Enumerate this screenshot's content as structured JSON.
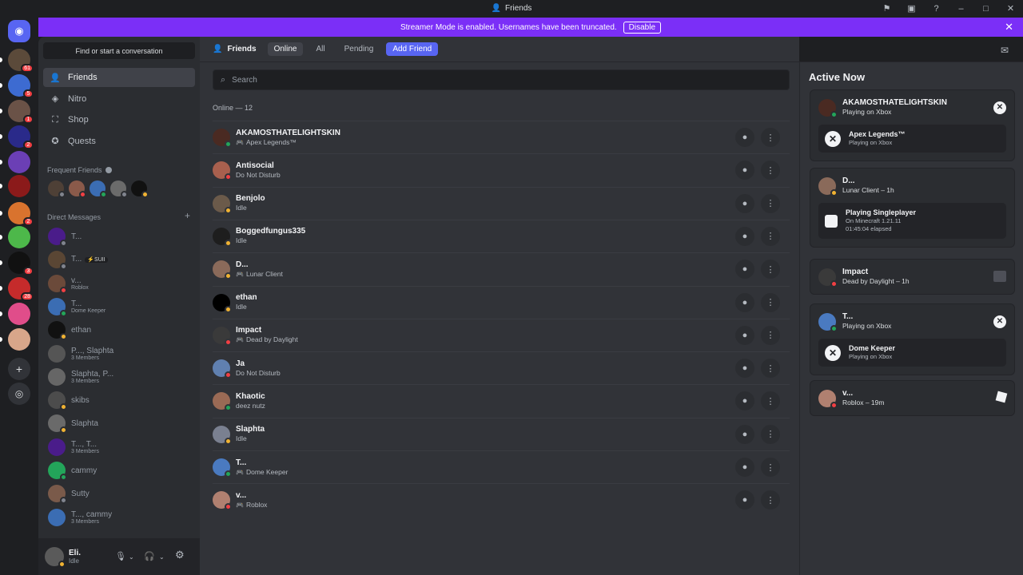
{
  "window": {
    "title": "Friends"
  },
  "banner": {
    "text": "Streamer Mode is enabled. Usernames have been truncated.",
    "button": "Disable"
  },
  "colors": {
    "accent": "#5865f2",
    "banner": "#7b2ff7",
    "online": "#23a55a",
    "idle": "#f0b232",
    "dnd": "#f23f43"
  },
  "servers": [
    {
      "badge": "61"
    },
    {
      "badge": "5"
    },
    {
      "badge": "1"
    },
    {
      "badge": "2"
    },
    {
      "badge": ""
    },
    {
      "badge": ""
    },
    {
      "badge": "2"
    },
    {
      "badge": ""
    },
    {
      "badge": "3"
    },
    {
      "badge": "28"
    },
    {
      "badge": ""
    },
    {
      "badge": ""
    }
  ],
  "sidebar": {
    "find": "Find or start a conversation",
    "nav": [
      {
        "label": "Friends",
        "icon": "friends-icon"
      },
      {
        "label": "Nitro",
        "icon": "nitro-icon"
      },
      {
        "label": "Shop",
        "icon": "shop-icon"
      },
      {
        "label": "Quests",
        "icon": "quests-icon"
      }
    ],
    "frequent_label": "Frequent Friends",
    "dm_label": "Direct Messages",
    "dms": [
      {
        "name": "T...",
        "sub": "",
        "tag": ""
      },
      {
        "name": "T...",
        "sub": "",
        "tag": "⚡SUII"
      },
      {
        "name": "v...",
        "sub": "Roblox",
        "tag": ""
      },
      {
        "name": "T...",
        "sub": "Dome Keeper",
        "tag": ""
      },
      {
        "name": "ethan",
        "sub": "",
        "tag": ""
      },
      {
        "name": "P..., Slaphta",
        "sub": "3 Members",
        "tag": ""
      },
      {
        "name": "Slaphta, P...",
        "sub": "3 Members",
        "tag": ""
      },
      {
        "name": "skibs",
        "sub": "",
        "tag": ""
      },
      {
        "name": "Slaphta",
        "sub": "",
        "tag": ""
      },
      {
        "name": "T..., T...",
        "sub": "3 Members",
        "tag": ""
      },
      {
        "name": "cammy",
        "sub": "",
        "tag": ""
      },
      {
        "name": "Sutty",
        "sub": "",
        "tag": ""
      },
      {
        "name": "T..., cammy",
        "sub": "3 Members",
        "tag": ""
      }
    ]
  },
  "user": {
    "name": "Eli.",
    "status": "Idle"
  },
  "topbar": {
    "title": "Friends",
    "tabs": [
      "Online",
      "All",
      "Pending"
    ],
    "add": "Add Friend"
  },
  "search": {
    "placeholder": "Search"
  },
  "online": {
    "heading": "Online — 12",
    "friends": [
      {
        "name": "AKAMOSTHATELIGHTSKIN",
        "status": "Apex Legends™",
        "game": true,
        "state": "online"
      },
      {
        "name": "Antisocial",
        "status": "Do Not Disturb",
        "game": false,
        "state": "dnd"
      },
      {
        "name": "Benjolo",
        "status": "Idle",
        "game": false,
        "state": "idle"
      },
      {
        "name": "Boggedfungus335",
        "status": "Idle",
        "game": false,
        "state": "idle"
      },
      {
        "name": "D...",
        "status": "Lunar Client",
        "game": true,
        "state": "idle"
      },
      {
        "name": "ethan",
        "status": "Idle",
        "game": false,
        "state": "idle"
      },
      {
        "name": "Impact",
        "status": "Dead by Daylight",
        "game": true,
        "state": "dnd"
      },
      {
        "name": "Ja",
        "status": "Do Not Disturb",
        "game": false,
        "state": "dnd"
      },
      {
        "name": "Khaotic",
        "status": "deez nutz",
        "game": false,
        "state": "online"
      },
      {
        "name": "Slaphta",
        "status": "Idle",
        "game": false,
        "state": "idle"
      },
      {
        "name": "T...",
        "status": "Dome Keeper",
        "game": true,
        "state": "online"
      },
      {
        "name": "v...",
        "status": "Roblox",
        "game": true,
        "state": "dnd"
      }
    ]
  },
  "active_now": {
    "title": "Active Now",
    "cards": [
      {
        "name": "AKAMOSTHATELIGHTSKIN",
        "status": "Playing on Xbox",
        "sub_title": "Apex Legends™",
        "sub_lines": [
          "Playing on Xbox"
        ]
      },
      {
        "name": "D...",
        "status": "Lunar Client – 1h",
        "sub_title": "Playing Singleplayer",
        "sub_lines": [
          "On Minecraft 1.21.11",
          "01:45:04 elapsed"
        ]
      },
      {
        "name": "Impact",
        "status": "Dead by Daylight – 1h",
        "sub_title": "",
        "sub_lines": []
      },
      {
        "name": "T...",
        "status": "Playing on Xbox",
        "sub_title": "Dome Keeper",
        "sub_lines": [
          "Playing on Xbox"
        ]
      },
      {
        "name": "v...",
        "status": "Roblox – 19m",
        "sub_title": "",
        "sub_lines": []
      }
    ]
  }
}
